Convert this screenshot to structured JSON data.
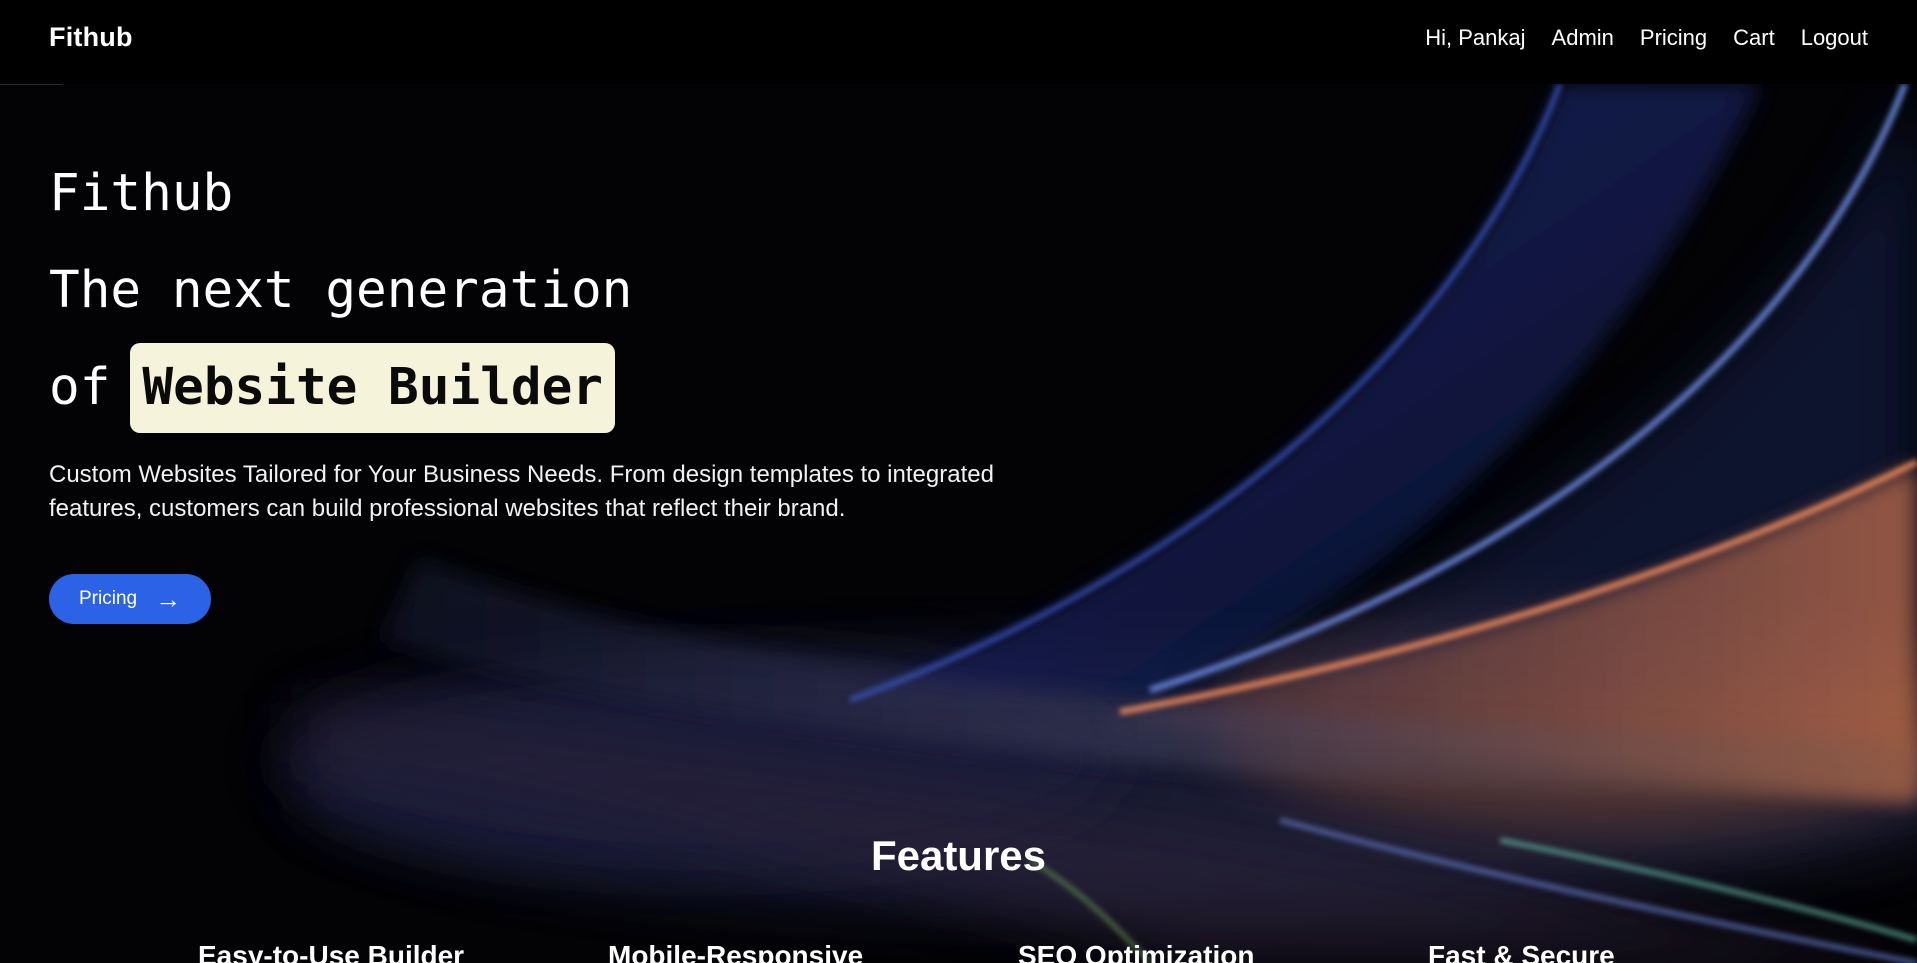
{
  "navbar": {
    "brand": "Fithub",
    "links": [
      "Hi, Pankaj",
      "Admin",
      "Pricing",
      "Cart",
      "Logout"
    ]
  },
  "hero": {
    "brand_line": "Fithub",
    "line1": "The next generation",
    "line2_prefix": "of",
    "line2_highlight": "Website Builder",
    "description": "Custom Websites Tailored for Your Business Needs. From design templates to integrated features, customers can build professional websites that reflect their brand.",
    "cta_label": "Pricing",
    "cta_icon": "arrow-right-icon"
  },
  "features": {
    "title": "Features",
    "items": [
      "Easy-to-Use Builder",
      "Mobile-Responsive",
      "SEO Optimization",
      "Fast & Secure"
    ]
  },
  "colors": {
    "background": "#030306",
    "accent": "#2c63e6",
    "highlight": "#f5f3da"
  }
}
